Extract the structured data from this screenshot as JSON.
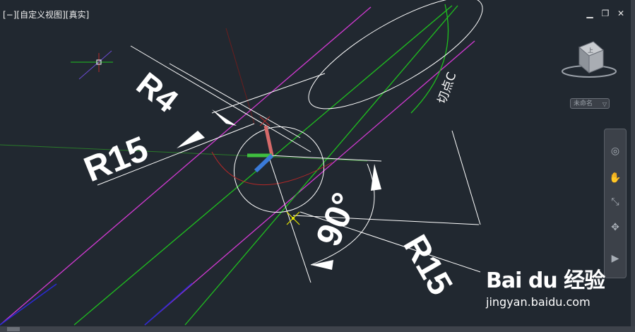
{
  "viewport": {
    "label": "[−][自定义视图][真实]",
    "window_controls": {
      "minimize": "▁",
      "restore": "❐",
      "close": "✕"
    }
  },
  "drawing": {
    "dim_r4": "R4",
    "dim_r15_left": "R15",
    "dim_angle": "90°",
    "dim_r15_right": "R15",
    "tangent_label": "切点C"
  },
  "viewcube": {
    "face_label": "上"
  },
  "ucs": {
    "name": "未命名",
    "chevron": "▽"
  },
  "navbar": {
    "icons": [
      "steering-wheel-icon",
      "pan-icon",
      "zoom-icon",
      "orbit-icon",
      "showmotion-icon"
    ]
  },
  "watermark": {
    "brand": "Bai du 经验",
    "url": "jingyan.baidu.com"
  },
  "colors": {
    "background": "#212830",
    "magenta": "#d33ad3",
    "green": "#1fc01f",
    "white": "#ffffff",
    "red": "#b52828",
    "yellow": "#e6e600",
    "blue": "#3060e0"
  }
}
